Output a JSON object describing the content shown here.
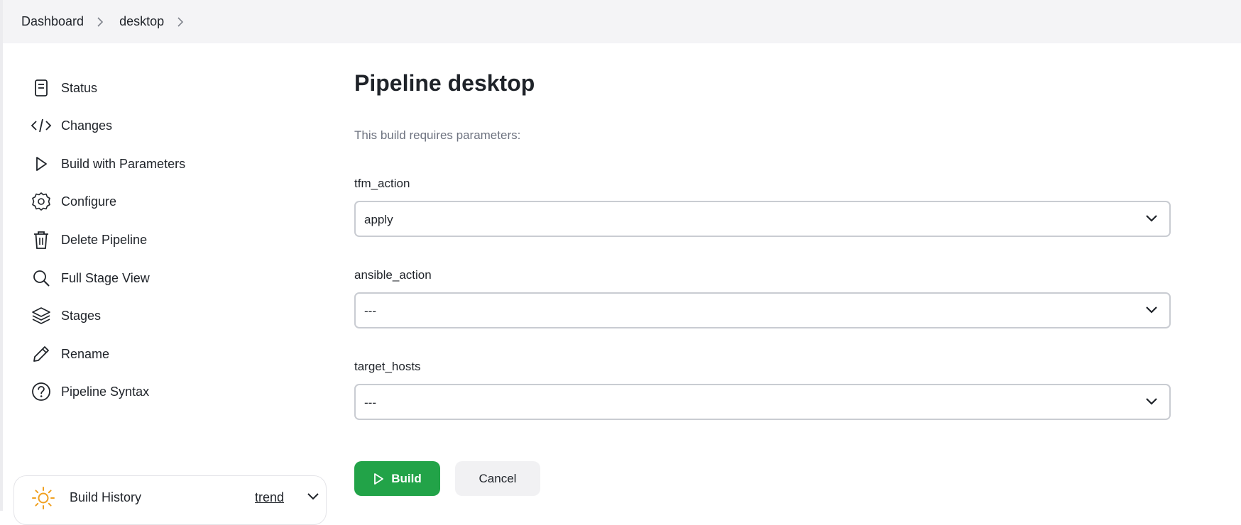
{
  "breadcrumb": {
    "items": [
      "Dashboard",
      "desktop"
    ]
  },
  "sidebar": {
    "items": [
      {
        "label": "Status",
        "icon": "document-icon"
      },
      {
        "label": "Changes",
        "icon": "code-icon"
      },
      {
        "label": "Build with Parameters",
        "icon": "play-icon"
      },
      {
        "label": "Configure",
        "icon": "gear-icon"
      },
      {
        "label": "Delete Pipeline",
        "icon": "trash-icon"
      },
      {
        "label": "Full Stage View",
        "icon": "search-icon"
      },
      {
        "label": "Stages",
        "icon": "layers-icon"
      },
      {
        "label": "Rename",
        "icon": "pencil-icon"
      },
      {
        "label": "Pipeline Syntax",
        "icon": "help-circle-icon"
      }
    ]
  },
  "build_history": {
    "title": "Build History",
    "trend_label": "trend",
    "icon": "sun-icon"
  },
  "main": {
    "title": "Pipeline desktop",
    "subtitle": "This build requires parameters:",
    "params": [
      {
        "name": "tfm_action",
        "value": "apply"
      },
      {
        "name": "ansible_action",
        "value": "---"
      },
      {
        "name": "target_hosts",
        "value": "---"
      }
    ],
    "build_label": "Build",
    "cancel_label": "Cancel"
  },
  "colors": {
    "build_button": "#22a348",
    "topbar": "#f4f4f6",
    "select_border": "#c9ccd2"
  }
}
